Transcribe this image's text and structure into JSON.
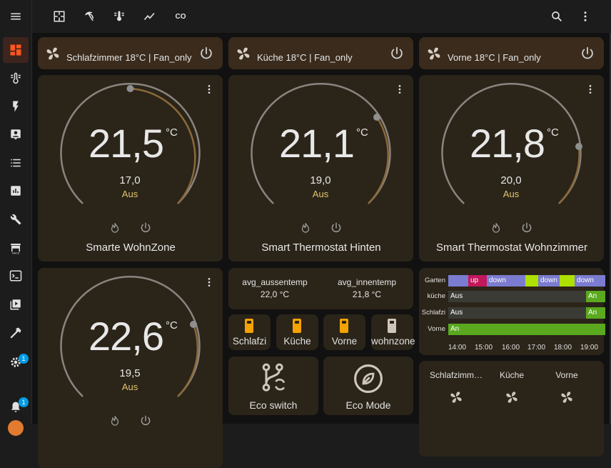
{
  "topbar": {
    "icons": [
      "floorplan-icon",
      "umbrella-icon",
      "thermometer-icon",
      "chart-line-icon",
      "co-icon"
    ],
    "co_label": "CO",
    "search_icon": "search-icon",
    "more_icon": "dots-vertical-icon"
  },
  "sidebar": {
    "menu_icon": "menu-icon",
    "items": [
      "dashboard-icon",
      "thermometer-lines-icon",
      "lightning-icon",
      "account-box-icon",
      "list-icon",
      "chart-box-icon",
      "wrench-icon",
      "store-icon",
      "console-icon",
      "media-icon",
      "hammer-icon",
      "gear-icon"
    ],
    "settings_badge": "1",
    "notifications_badge": "1",
    "accent": "#ff5722"
  },
  "headers": [
    {
      "title": "Schlafzimmer 18°C | Fan_only"
    },
    {
      "title": "Küche 18°C | Fan_only"
    },
    {
      "title": "Vorne 18°C | Fan_only"
    }
  ],
  "thermostats": [
    {
      "temp": "21,5",
      "unit": "°C",
      "target": "17,0",
      "mode": "Aus",
      "name": "Smarte WohnZone"
    },
    {
      "temp": "21,1",
      "unit": "°C",
      "target": "19,0",
      "mode": "Aus",
      "name": "Smart Thermostat Hinten"
    },
    {
      "temp": "21,8",
      "unit": "°C",
      "target": "20,0",
      "mode": "Aus",
      "name": "Smart Thermostat Wohnzimmer"
    },
    {
      "temp": "22,6",
      "unit": "°C",
      "target": "19,5",
      "mode": "Aus",
      "name": ""
    }
  ],
  "averages": {
    "outside_label": "avg_aussentemp",
    "outside_value": "22,0 °C",
    "inside_label": "avg_innentemp",
    "inside_value": "21,8 °C"
  },
  "devices": [
    {
      "label": "Schlafzi",
      "on": true
    },
    {
      "label": "Küche",
      "on": true
    },
    {
      "label": "Vorne",
      "on": true
    },
    {
      "label": "wohnzone",
      "on": false
    }
  ],
  "buttons": {
    "eco_switch": "Eco switch",
    "eco_mode": "Eco Mode"
  },
  "timeline": {
    "rows": [
      {
        "label": "Garten",
        "segments": [
          {
            "text": "",
            "color": "#7b7bd0"
          },
          {
            "text": "up",
            "color": "#c2185b"
          },
          {
            "text": "down",
            "color": "#7b7bd0"
          },
          {
            "text": "",
            "color": "#aee000"
          },
          {
            "text": "down",
            "color": "#7b7bd0"
          },
          {
            "text": "",
            "color": "#aee000"
          },
          {
            "text": "down",
            "color": "#7b7bd0"
          }
        ]
      },
      {
        "label": "küche",
        "segments": [
          {
            "text": "Aus",
            "color": "#3b3b36"
          },
          {
            "text": "An",
            "color": "#5aa91f"
          }
        ]
      },
      {
        "label": "Schlafzi",
        "segments": [
          {
            "text": "Aus",
            "color": "#3b3b36"
          },
          {
            "text": "An",
            "color": "#5aa91f"
          }
        ]
      },
      {
        "label": "Vorne",
        "segments": [
          {
            "text": "An",
            "color": "#5aa91f"
          }
        ]
      }
    ],
    "ticks": [
      "14:00",
      "15:00",
      "16:00",
      "17:00",
      "18:00",
      "19:00"
    ]
  },
  "fans": [
    {
      "label": "Schlafzimm…"
    },
    {
      "label": "Küche"
    },
    {
      "label": "Vorne"
    }
  ]
}
